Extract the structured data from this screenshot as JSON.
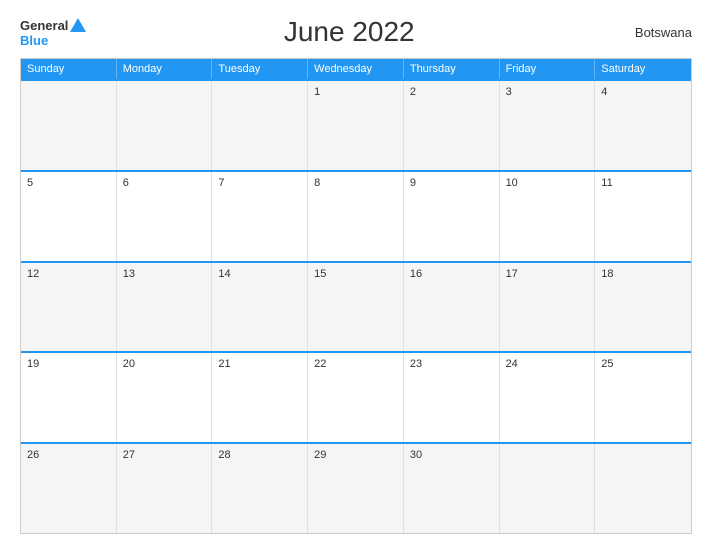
{
  "header": {
    "logo_general": "General",
    "logo_blue": "Blue",
    "title": "June 2022",
    "country": "Botswana"
  },
  "calendar": {
    "days": [
      "Sunday",
      "Monday",
      "Tuesday",
      "Wednesday",
      "Thursday",
      "Friday",
      "Saturday"
    ],
    "weeks": [
      [
        {
          "num": "",
          "empty": true
        },
        {
          "num": "",
          "empty": true
        },
        {
          "num": "",
          "empty": true
        },
        {
          "num": "1",
          "empty": false
        },
        {
          "num": "2",
          "empty": false
        },
        {
          "num": "3",
          "empty": false
        },
        {
          "num": "4",
          "empty": false
        }
      ],
      [
        {
          "num": "5",
          "empty": false
        },
        {
          "num": "6",
          "empty": false
        },
        {
          "num": "7",
          "empty": false
        },
        {
          "num": "8",
          "empty": false
        },
        {
          "num": "9",
          "empty": false
        },
        {
          "num": "10",
          "empty": false
        },
        {
          "num": "11",
          "empty": false
        }
      ],
      [
        {
          "num": "12",
          "empty": false
        },
        {
          "num": "13",
          "empty": false
        },
        {
          "num": "14",
          "empty": false
        },
        {
          "num": "15",
          "empty": false
        },
        {
          "num": "16",
          "empty": false
        },
        {
          "num": "17",
          "empty": false
        },
        {
          "num": "18",
          "empty": false
        }
      ],
      [
        {
          "num": "19",
          "empty": false
        },
        {
          "num": "20",
          "empty": false
        },
        {
          "num": "21",
          "empty": false
        },
        {
          "num": "22",
          "empty": false
        },
        {
          "num": "23",
          "empty": false
        },
        {
          "num": "24",
          "empty": false
        },
        {
          "num": "25",
          "empty": false
        }
      ],
      [
        {
          "num": "26",
          "empty": false
        },
        {
          "num": "27",
          "empty": false
        },
        {
          "num": "28",
          "empty": false
        },
        {
          "num": "29",
          "empty": false
        },
        {
          "num": "30",
          "empty": false
        },
        {
          "num": "",
          "empty": true
        },
        {
          "num": "",
          "empty": true
        }
      ]
    ]
  }
}
